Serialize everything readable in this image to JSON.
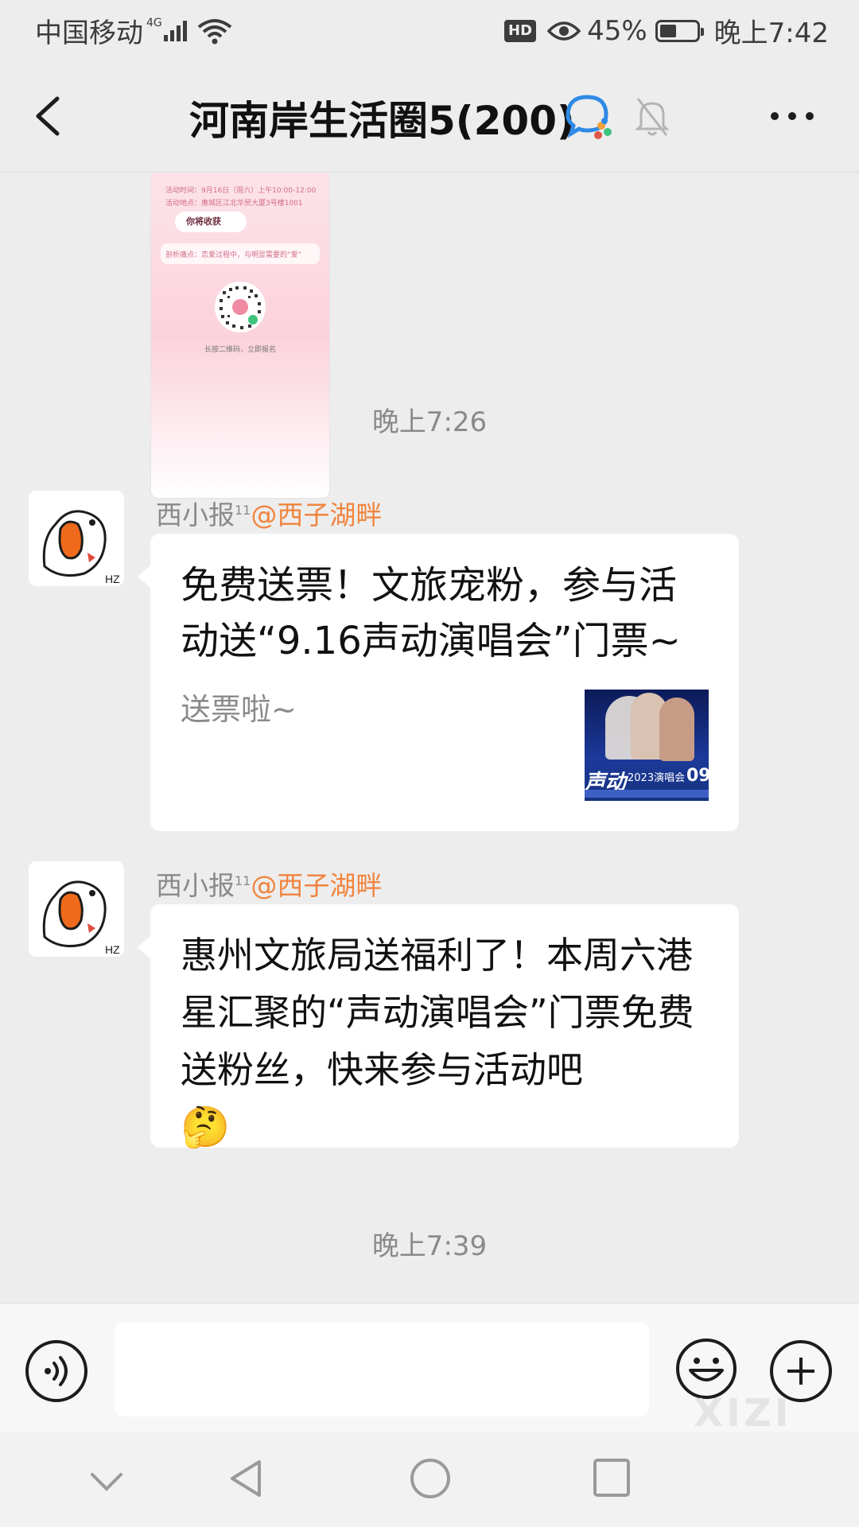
{
  "status_bar": {
    "carrier": "中国移动",
    "network": "4G",
    "hd": "HD",
    "battery_percent": "45%",
    "battery_level": 0.45,
    "time": "晚上7:42"
  },
  "header": {
    "title": "河南岸生活圈5(200)"
  },
  "poster": {
    "line1": "活动时间：9月16日（周六）上午10:00-12:00",
    "line2": "活动地点：惠城区江北华贸大厦3号楼1001",
    "section": "你将收获",
    "line3": "剖析痛点：恋爱过程中，与明显需要的“爱”",
    "footer": "长按二维码，立即报名"
  },
  "messages": [
    {
      "timestamp": "晚上7:26",
      "sender_name": "西小报",
      "sender_sup": "11",
      "sender_mention": "@西子湖畔",
      "link_title": "免费送票！文旅宠粉，参与活动送“9.16声动演唱会”门票~",
      "link_desc": "送票啦~",
      "thumb_text_top": "声动",
      "thumb_text_mid": "2023演唱会",
      "thumb_date": "09"
    },
    {
      "sender_name": "西小报",
      "sender_sup": "11",
      "sender_mention": "@西子湖畔",
      "text": "惠州文旅局送福利了！本周六港星汇聚的“声动演唱会”门票免费送粉丝，快来参与活动吧",
      "emoji": "🤔"
    }
  ],
  "timestamp_bottom": "晚上7:39",
  "input_bar": {
    "watermark": "XIZI"
  },
  "colors": {
    "mention": "#f0843e",
    "background": "#ededed",
    "bubble": "#ffffff"
  }
}
